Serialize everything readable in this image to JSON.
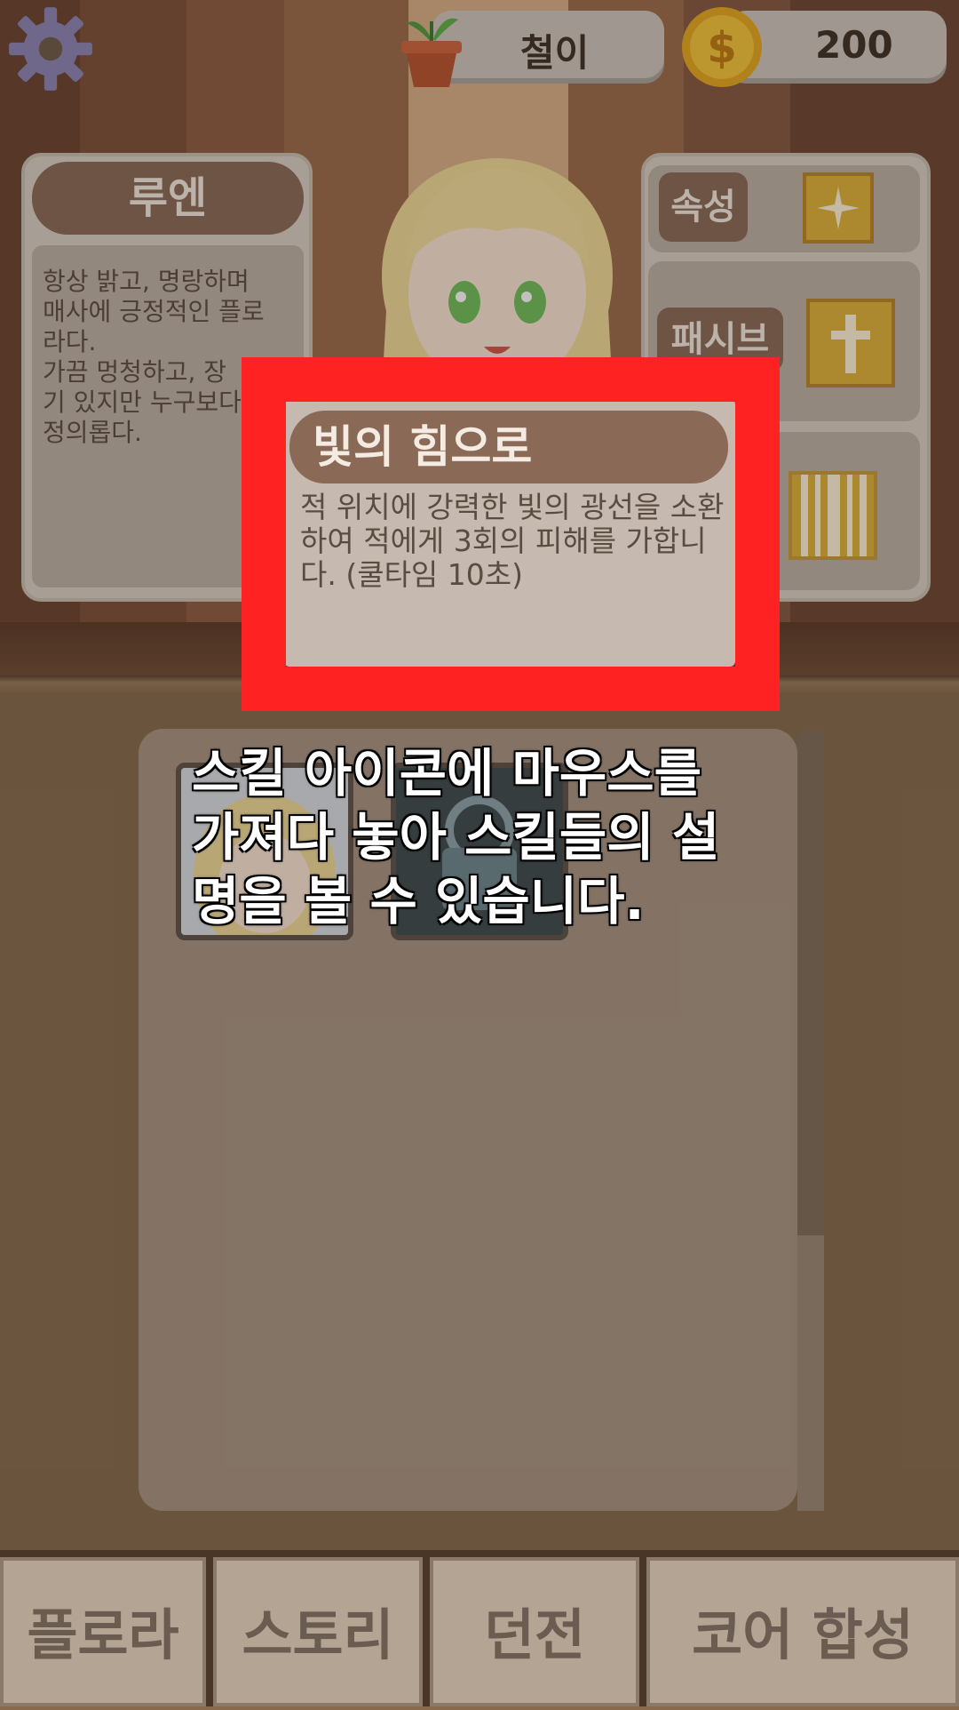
{
  "header": {
    "player_name": "철이",
    "gold": "200"
  },
  "character": {
    "name": "루엔",
    "description": "항상 밝고, 명랑하며\n매사에 긍정적인 플로\n라다.\n가끔 멍청하고, 장\n기 있지만 누구보다\n정의롭다."
  },
  "attributes": {
    "element_label": "속성",
    "passive_label": "패시브"
  },
  "tooltip": {
    "title": "빛의 힘으로",
    "description": "적 위치에 강력한 빛의 광선을 소환하여 적에게 3회의 피해를 가합니다. (쿨타임 10초)"
  },
  "tutorial": {
    "caption": "스킬 아이콘에 마우스를\n가져다 놓아 스킬들의 설\n명을 볼 수 있습니다."
  },
  "nav": {
    "items": [
      {
        "label": "플로라"
      },
      {
        "label": "스토리"
      },
      {
        "label": "던전"
      },
      {
        "label": "코어 합성"
      }
    ]
  },
  "colors": {
    "highlight": "#ff2222",
    "panel_tag": "#8a6a56",
    "gold_icon": "#e0b23a"
  },
  "icons": [
    "gear-icon",
    "flower-pot-icon",
    "coin-icon",
    "star-icon",
    "cross-icon",
    "stripes-icon"
  ]
}
